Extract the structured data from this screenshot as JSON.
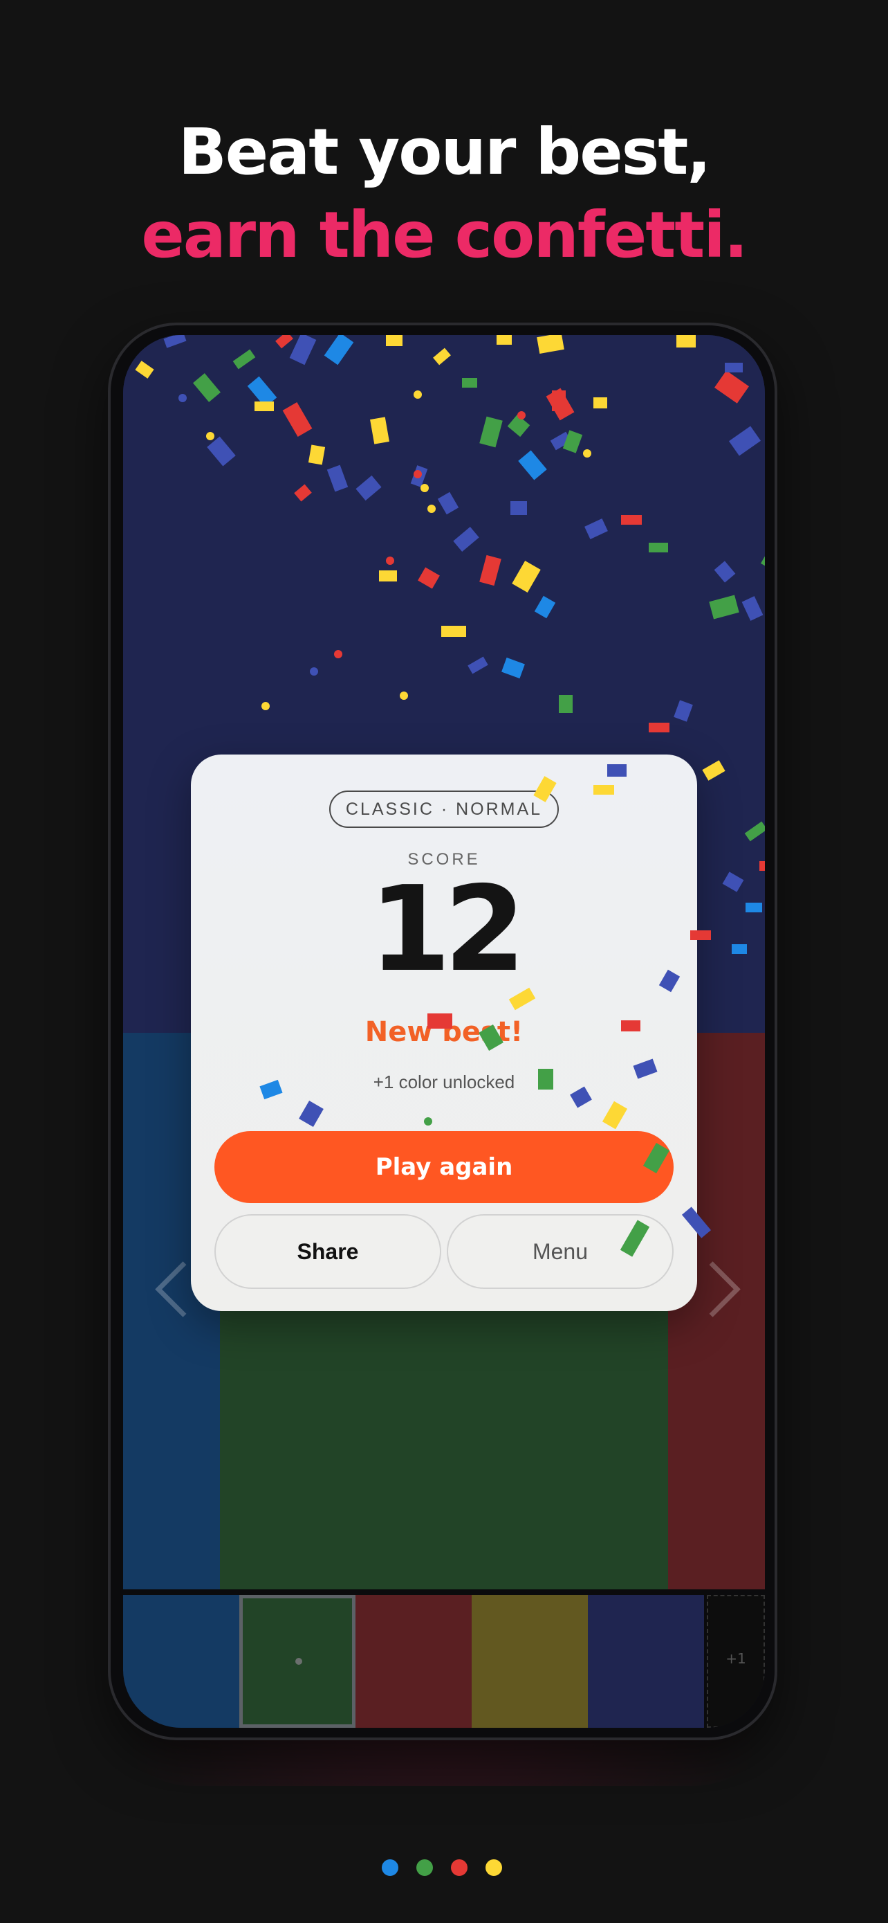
{
  "headline": {
    "line1": "Beat your best,",
    "line2": "earn the confetti."
  },
  "result_card": {
    "mode": "CLASSIC · NORMAL",
    "score_label": "SCORE",
    "score": "12",
    "badge": "New best!",
    "unlock_text": "+1 color unlocked",
    "play_again": "Play again",
    "share": "Share",
    "menu": "Menu"
  },
  "swatch_bar": {
    "locked_label": "+1"
  },
  "colors": {
    "accent": "#ff5722",
    "headline_highlight": "#ec2a66",
    "blue": "#1e88e5",
    "green": "#43a047",
    "red": "#e53935",
    "yellow": "#fdd835",
    "indigo": "#3f51b5"
  },
  "page_indicator": {
    "dots": [
      "#1e88e5",
      "#43a047",
      "#e53935",
      "#fdd835"
    ]
  }
}
